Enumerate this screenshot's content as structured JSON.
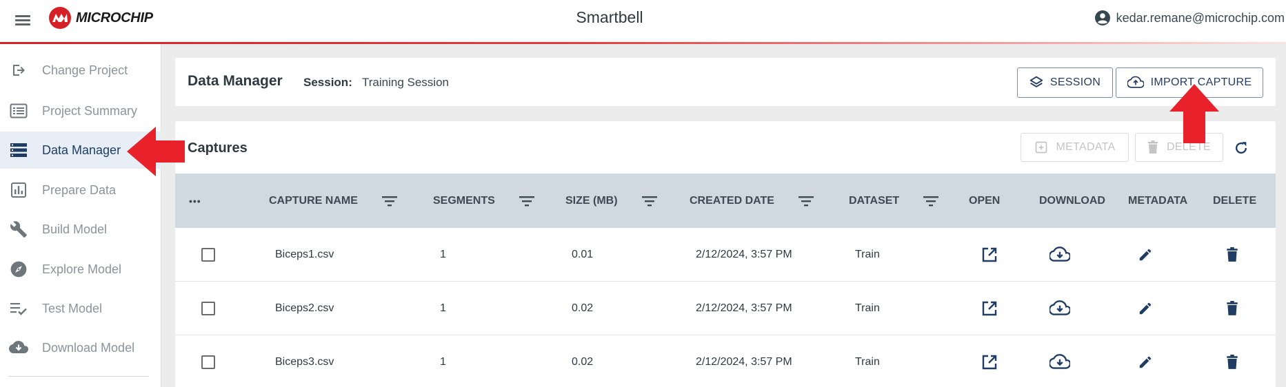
{
  "header": {
    "logo_text": "MICROCHIP",
    "app_title": "Smartbell",
    "user_email": "kedar.remane@microchip.com"
  },
  "sidebar": {
    "items": [
      {
        "label": "Change Project",
        "icon": "login-icon"
      },
      {
        "label": "Project Summary",
        "icon": "summary-icon"
      },
      {
        "label": "Data Manager",
        "icon": "storage-icon",
        "active": true
      },
      {
        "label": "Prepare Data",
        "icon": "chart-icon"
      },
      {
        "label": "Build Model",
        "icon": "wrench-icon"
      },
      {
        "label": "Explore Model",
        "icon": "compass-icon"
      },
      {
        "label": "Test Model",
        "icon": "checklist-icon"
      },
      {
        "label": "Download Model",
        "icon": "cloud-download-icon"
      }
    ]
  },
  "data_manager": {
    "title": "Data Manager",
    "session_label": "Session:",
    "session_value": "Training Session",
    "session_button": "SESSION",
    "import_button": "IMPORT CAPTURE"
  },
  "captures": {
    "title": "Captures",
    "metadata_button": "METADATA",
    "delete_button": "DELETE",
    "columns": {
      "menu": "•••",
      "capture_name": "CAPTURE NAME",
      "segments": "SEGMENTS",
      "size": "SIZE (MB)",
      "created_date": "CREATED DATE",
      "dataset": "DATASET",
      "open": "OPEN",
      "download": "DOWNLOAD",
      "metadata": "METADATA",
      "delete": "DELETE"
    },
    "rows": [
      {
        "name": "Biceps1.csv",
        "segments": "1",
        "size": "0.01",
        "created": "2/12/2024, 3:57 PM",
        "dataset": "Train"
      },
      {
        "name": "Biceps2.csv",
        "segments": "1",
        "size": "0.02",
        "created": "2/12/2024, 3:57 PM",
        "dataset": "Train"
      },
      {
        "name": "Biceps3.csv",
        "segments": "1",
        "size": "0.02",
        "created": "2/12/2024, 3:57 PM",
        "dataset": "Train"
      }
    ]
  },
  "colors": {
    "brand_red": "#d71f26",
    "primary_navy": "#1f3d63",
    "table_header": "#d0d9e0",
    "annotation_arrow": "#e8212b"
  }
}
